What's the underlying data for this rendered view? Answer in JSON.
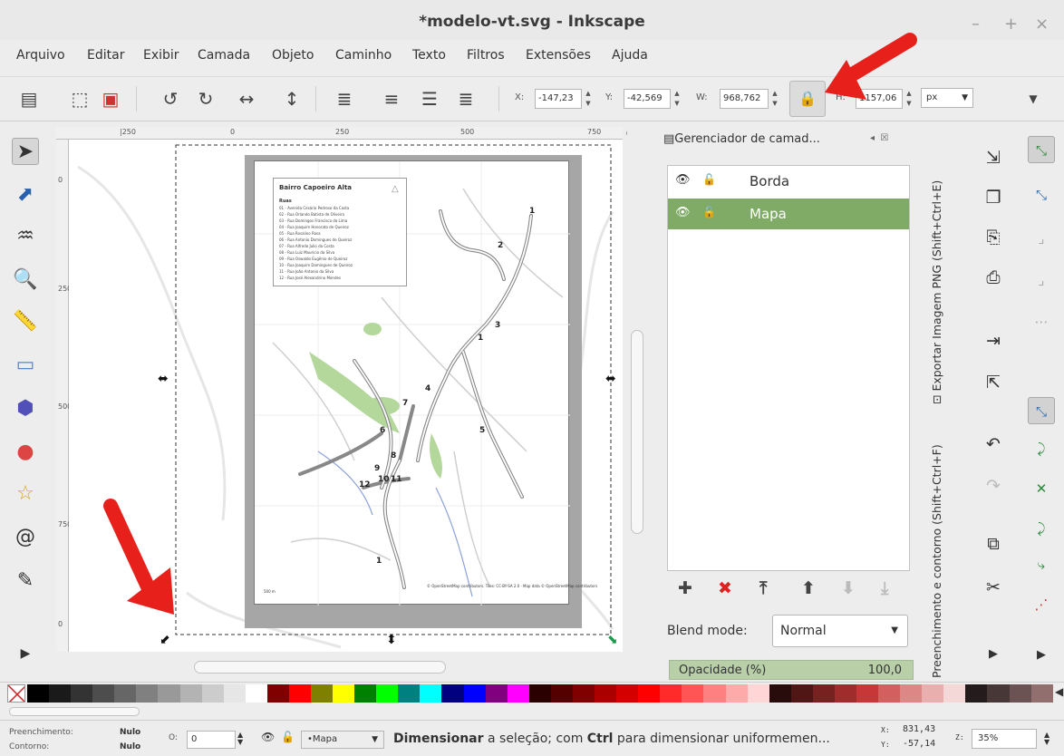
{
  "window": {
    "title": "*modelo-vt.svg - Inkscape",
    "controls": [
      "–",
      "+",
      "×"
    ]
  },
  "menu": [
    "Arquivo",
    "Editar",
    "Exibir",
    "Camada",
    "Objeto",
    "Caminho",
    "Texto",
    "Filtros",
    "Extensões",
    "Ajuda"
  ],
  "toolbar": {
    "x_label": "X:",
    "x_value": "-147,23",
    "y_label": "Y:",
    "y_value": "-42,569",
    "w_label": "W:",
    "w_value": "968,762",
    "h_label": "H:",
    "h_value": "1157,06",
    "unit": "px",
    "icons": [
      "document-properties-icon",
      "select-all-icon",
      "zoom-drawing-icon",
      "rotate-ccw-icon",
      "rotate-cw-icon",
      "flip-horizontal-icon",
      "flip-vertical-icon",
      "raise-to-top-icon",
      "raise-icon",
      "lower-icon",
      "lower-to-bottom-icon",
      "lock-ratio-icon",
      "toolbar-overflow-icon"
    ]
  },
  "tools": [
    "selector-icon",
    "node-icon",
    "tweak-icon",
    "zoom-icon",
    "measure-icon",
    "rectangle-icon",
    "3d-box-icon",
    "ellipse-icon",
    "star-icon",
    "spiral-icon",
    "pencil-icon",
    "more-tools-icon"
  ],
  "rulers": {
    "top_labels": [
      "|250",
      "0",
      "250",
      "500",
      "750"
    ],
    "left_labels": [
      "0",
      "250",
      "500",
      "750",
      "0"
    ]
  },
  "map": {
    "legend_title": "Bairro Capoeiro Alta",
    "legend_subtitle": "Ruas",
    "legend_items": [
      "01 - Avenida Cesário Pedroso da Costa",
      "02 - Rua Orlando Batista de Oliveira",
      "03 - Rua Domingos Francisco da Lima",
      "04 - Rua Joaquim Honorato de Queiroz",
      "05 - Rua Rosalino Rosa",
      "06 - Rua Antonio Domingues de Queiroz",
      "07 - Rua Alfredo Julio da Costa",
      "08 - Rua Luiz Mauricio da Silva",
      "09 - Rua Oswaldo Eugênio de Queiroz",
      "10 - Rua Joaquim Domingues de Queiroz",
      "11 - Rua João Antonio da Silva",
      "12 - Rua José Alexandrino Mendes"
    ],
    "attribution": "© OpenStreetMap contributors. Tiles: CC-BY-SA 2.0 · Map data © OpenStreetMap contributors",
    "scale": "500 m",
    "street_numbers": [
      "1",
      "2",
      "3",
      "1",
      "4",
      "7",
      "6",
      "5",
      "8",
      "9",
      "10",
      "11",
      "12",
      "1"
    ]
  },
  "layers_panel": {
    "title": "Gerenciador de camad...",
    "layers": [
      {
        "name": "Borda",
        "selected": false
      },
      {
        "name": "Mapa",
        "selected": true
      }
    ],
    "buttons": [
      "add-layer-icon",
      "delete-layer-icon",
      "layer-to-top-icon",
      "layer-up-icon",
      "layer-down-icon",
      "layer-to-bottom-icon"
    ],
    "blend_label": "Blend mode:",
    "blend_value": "Normal",
    "opacity_label": "Opacidade (%)",
    "opacity_value": "100,0"
  },
  "side_tabs": [
    "Exportar Imagem PNG (Shift+Ctrl+E)",
    "Preenchimento e contorno (Shift+Ctrl+F)"
  ],
  "commands": [
    "import-icon",
    "duplicate-icon",
    "export-bitmap-icon",
    "print-icon",
    "open-icon",
    "save-icon",
    "undo-icon",
    "redo-icon",
    "copy-icon",
    "cut-icon",
    "more-commands-icon"
  ],
  "snaps": [
    "snap-toggle-icon",
    "snap-bbox-icon",
    "snap-bbox-edge-icon",
    "snap-bbox-corner-icon",
    "snap-midpoint-icon",
    "snap-nodes-icon",
    "snap-path-icon",
    "snap-intersection-icon",
    "snap-smooth-icon",
    "snap-midpoint-path-icon",
    "snap-center-icon",
    "more-snaps-icon"
  ],
  "palette": {
    "colors": [
      "#000000",
      "#1a1a1a",
      "#333333",
      "#4d4d4d",
      "#666666",
      "#808080",
      "#999999",
      "#b3b3b3",
      "#cccccc",
      "#e6e6e6",
      "#ffffff",
      "#800000",
      "#ff0000",
      "#808000",
      "#ffff00",
      "#008000",
      "#00ff00",
      "#008080",
      "#00ffff",
      "#000080",
      "#0000ff",
      "#800080",
      "#ff00ff",
      "#2b0000",
      "#550000",
      "#800000",
      "#aa0000",
      "#d40000",
      "#ff0000",
      "#ff2a2a",
      "#ff5555",
      "#ff8080",
      "#ffaaaa",
      "#ffd5d5",
      "#280b0b",
      "#501616",
      "#782121",
      "#a02c2c",
      "#c83737",
      "#d35f5f",
      "#de8787",
      "#e9afaf",
      "#f4d7d7",
      "#241c1c",
      "#483737",
      "#6c5353",
      "#916f6f"
    ]
  },
  "status": {
    "fill_label": "Preenchimento:",
    "fill_value": "Nulo",
    "stroke_label": "Contorno:",
    "stroke_value": "Nulo",
    "opacity_label": "O:",
    "opacity_value": "0",
    "layer": "•Mapa",
    "message_bold": "Dimensionar",
    "message_mid": " a seleção; com ",
    "message_bold2": "Ctrl",
    "message_end": " para dimensionar uniformemen...",
    "x_label": "X:",
    "x_value": "831,43",
    "y_label": "Y:",
    "y_value": "-57,14",
    "z_label": "Z:",
    "zoom": "35%"
  },
  "annotation_color": "#e8201c"
}
